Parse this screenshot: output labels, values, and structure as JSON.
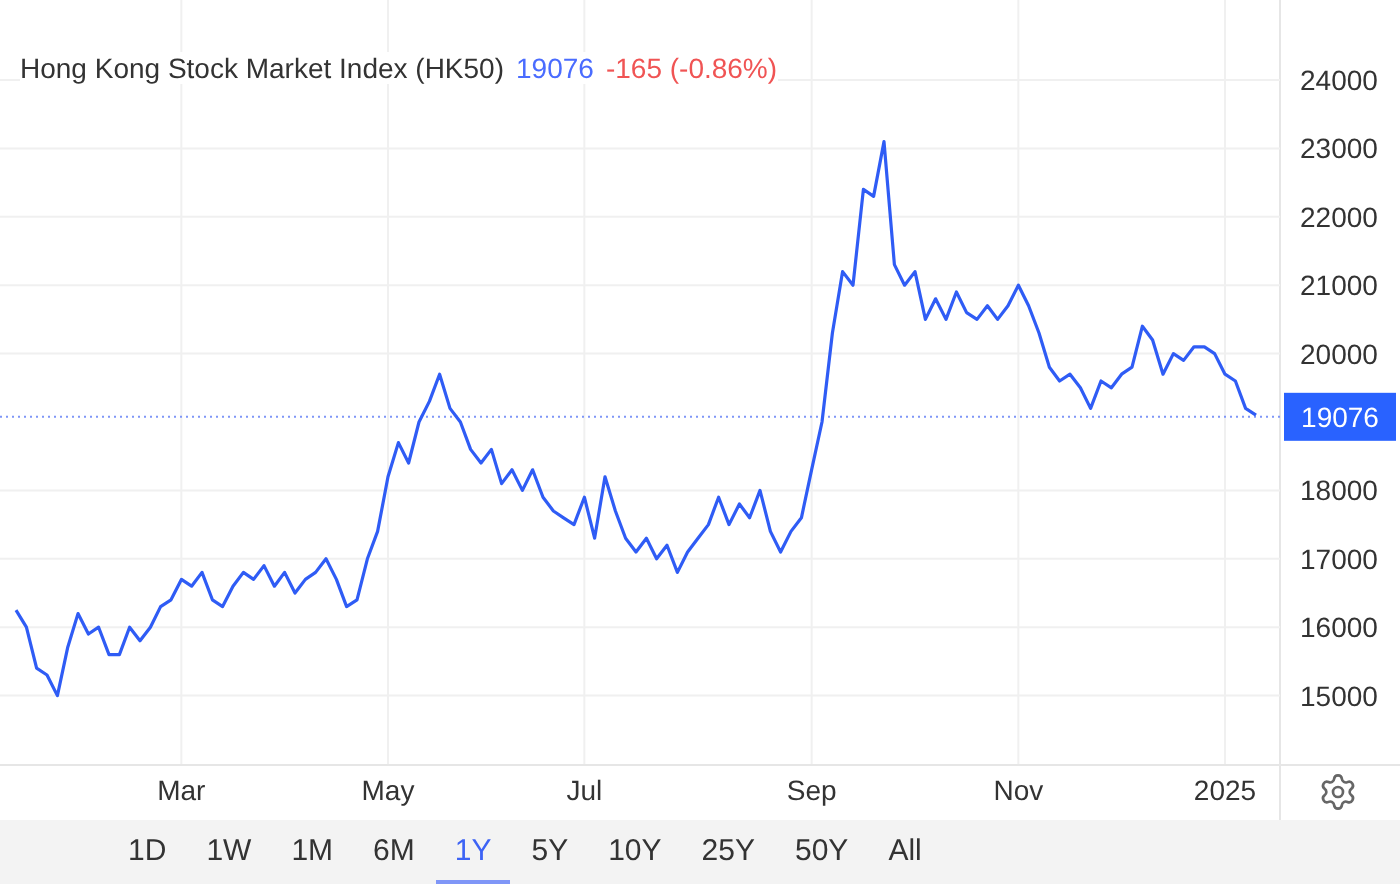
{
  "title": {
    "name": "Hong Kong Stock Market Index (HK50)",
    "price": "19076",
    "change": "-165 (-0.86%)"
  },
  "chart_data": {
    "type": "line",
    "grid": true,
    "ref_lines": [
      {
        "axis": "y",
        "color": "#7f96f7",
        "value": 19076,
        "label": "19076"
      }
    ],
    "ylim": [
      14000,
      25170
    ],
    "yticks": [
      15000,
      16000,
      17000,
      18000,
      20000,
      21000,
      22000,
      23000,
      24000
    ],
    "categories": [
      null,
      null,
      null,
      null,
      null,
      null,
      null,
      null,
      null,
      null,
      null,
      null,
      null,
      null,
      null,
      null,
      "Mar",
      null,
      null,
      null,
      null,
      null,
      null,
      null,
      null,
      null,
      null,
      null,
      null,
      null,
      null,
      null,
      null,
      null,
      null,
      null,
      "May",
      null,
      null,
      null,
      null,
      null,
      null,
      null,
      null,
      null,
      null,
      null,
      null,
      null,
      null,
      null,
      null,
      null,
      null,
      "Jul",
      null,
      null,
      null,
      null,
      null,
      null,
      null,
      null,
      null,
      null,
      null,
      null,
      null,
      null,
      null,
      null,
      null,
      null,
      null,
      null,
      null,
      "Sep",
      null,
      null,
      null,
      null,
      null,
      null,
      null,
      null,
      null,
      null,
      null,
      null,
      null,
      null,
      null,
      null,
      null,
      null,
      null,
      "Nov",
      null,
      null,
      null,
      null,
      null,
      null,
      null,
      null,
      null,
      null,
      null,
      null,
      null,
      null,
      null,
      null,
      null,
      null,
      null,
      "2025",
      null,
      null,
      null
    ],
    "series": [
      {
        "color": "#2f5cf5",
        "values": [
          16250,
          16000,
          15400,
          15300,
          15000,
          15700,
          16200,
          15900,
          16000,
          15600,
          15600,
          16000,
          15800,
          16000,
          16300,
          16400,
          16700,
          16600,
          16800,
          16400,
          16300,
          16600,
          16800,
          16700,
          16900,
          16600,
          16800,
          16500,
          16700,
          16800,
          17000,
          16700,
          16300,
          16400,
          17000,
          17400,
          18200,
          18700,
          18400,
          19000,
          19300,
          19700,
          19200,
          19000,
          18600,
          18400,
          18600,
          18100,
          18300,
          18000,
          18300,
          17900,
          17700,
          17600,
          17500,
          17900,
          17300,
          18200,
          17700,
          17300,
          17100,
          17300,
          17000,
          17200,
          16800,
          17100,
          17300,
          17500,
          17900,
          17500,
          17800,
          17600,
          18000,
          17400,
          17100,
          17400,
          17600,
          18300,
          19000,
          20300,
          21200,
          21000,
          22400,
          22300,
          23100,
          21300,
          21000,
          21200,
          20500,
          20800,
          20500,
          20900,
          20600,
          20500,
          20700,
          20500,
          20700,
          21000,
          20700,
          20300,
          19800,
          19600,
          19700,
          19500,
          19200,
          19600,
          19500,
          19700,
          19800,
          20400,
          20200,
          19700,
          20000,
          19900,
          20100,
          20100,
          20000,
          19700,
          19600,
          19200,
          19100
        ]
      }
    ]
  },
  "ranges": [
    {
      "label": "1D",
      "selected": false
    },
    {
      "label": "1W",
      "selected": false
    },
    {
      "label": "1M",
      "selected": false
    },
    {
      "label": "6M",
      "selected": false
    },
    {
      "label": "1Y",
      "selected": true
    },
    {
      "label": "5Y",
      "selected": false
    },
    {
      "label": "10Y",
      "selected": false
    },
    {
      "label": "25Y",
      "selected": false
    },
    {
      "label": "50Y",
      "selected": false
    },
    {
      "label": "All",
      "selected": false
    }
  ]
}
